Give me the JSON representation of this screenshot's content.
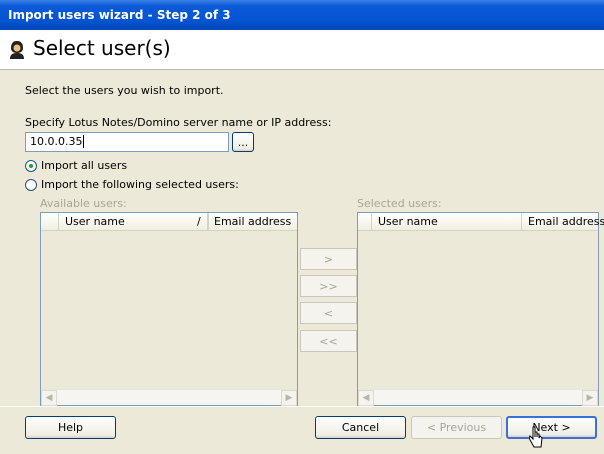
{
  "window": {
    "title": "Import users wizard - Step 2 of 3"
  },
  "header": {
    "title": "Select user(s)",
    "icon": "user-import-icon"
  },
  "instruction": "Select the users you wish to import.",
  "server": {
    "label": "Specify Lotus Notes/Domino server name or IP address:",
    "value": "10.0.0.35",
    "browse_label": "..."
  },
  "options": {
    "import_all": "Import all users",
    "import_selected": "Import the following selected users:",
    "selected": "import_all"
  },
  "available": {
    "label": "Available users:",
    "columns": [
      "User name",
      "/",
      "Email address"
    ]
  },
  "selected_users": {
    "label": "Selected users:",
    "columns": [
      "User name",
      "Email address"
    ]
  },
  "move_buttons": [
    ">",
    ">>",
    "<",
    "<<"
  ],
  "footer": {
    "help": "Help",
    "cancel": "Cancel",
    "previous": "< Previous",
    "next": "Next >"
  },
  "colors": {
    "titlebar": "#0554d2",
    "dialog_bg": "#ECE9D8",
    "accent": "#003c74"
  }
}
